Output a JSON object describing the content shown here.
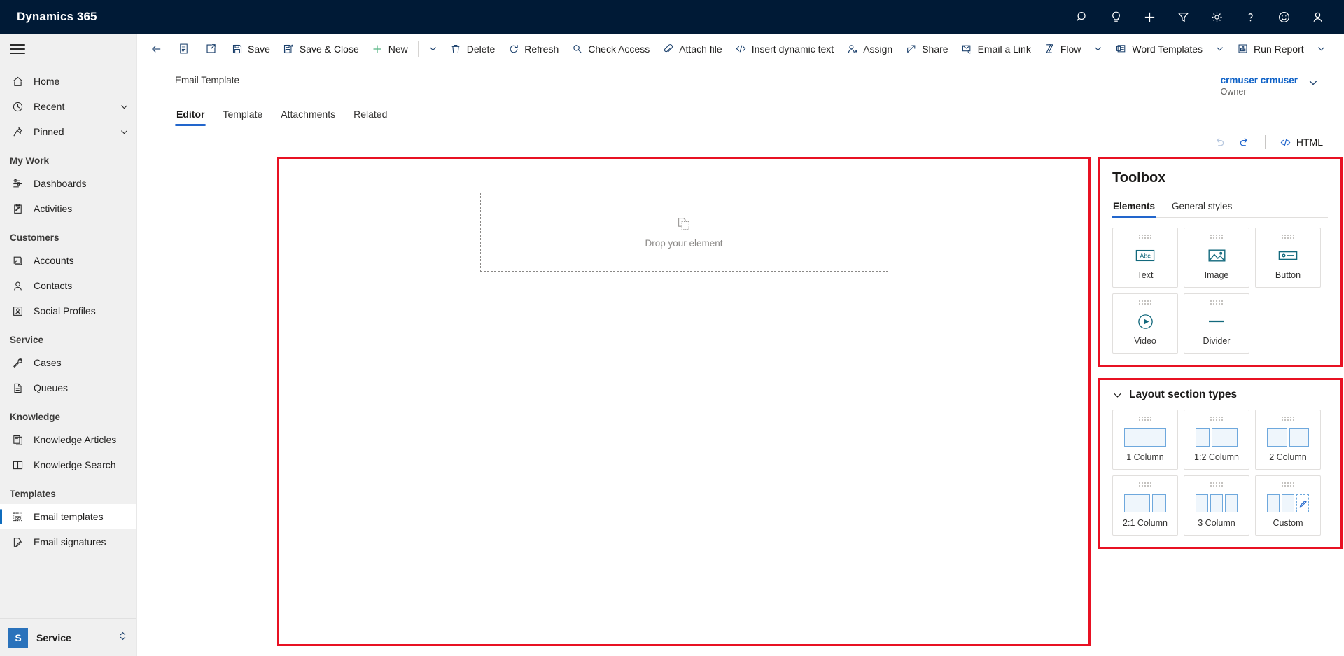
{
  "topbar": {
    "brand": "Dynamics 365",
    "icons": [
      {
        "name": "search-icon",
        "label": "Search"
      },
      {
        "name": "lightbulb-icon",
        "label": "Insights"
      },
      {
        "name": "plus-icon",
        "label": "New"
      },
      {
        "name": "filter-icon",
        "label": "Filter"
      },
      {
        "name": "gear-icon",
        "label": "Settings"
      },
      {
        "name": "question-icon",
        "label": "Help"
      },
      {
        "name": "smiley-icon",
        "label": "Feedback"
      },
      {
        "name": "person-icon",
        "label": "Account manager"
      }
    ]
  },
  "sidebar": {
    "items": [
      {
        "label": "Home",
        "icon": "home-icon",
        "type": "item",
        "chevron": false,
        "selected": false
      },
      {
        "label": "Recent",
        "icon": "clock-icon",
        "type": "item",
        "chevron": true,
        "selected": false
      },
      {
        "label": "Pinned",
        "icon": "pin-icon",
        "type": "item",
        "chevron": true,
        "selected": false
      },
      {
        "label": "My Work",
        "type": "group"
      },
      {
        "label": "Dashboards",
        "icon": "dashboard-icon",
        "type": "item",
        "chevron": false,
        "selected": false
      },
      {
        "label": "Activities",
        "icon": "activities-icon",
        "type": "item",
        "chevron": false,
        "selected": false
      },
      {
        "label": "Customers",
        "type": "group"
      },
      {
        "label": "Accounts",
        "icon": "accounts-icon",
        "type": "item",
        "chevron": false,
        "selected": false
      },
      {
        "label": "Contacts",
        "icon": "contacts-icon",
        "type": "item",
        "chevron": false,
        "selected": false
      },
      {
        "label": "Social Profiles",
        "icon": "social-profile-icon",
        "type": "item",
        "chevron": false,
        "selected": false
      },
      {
        "label": "Service",
        "type": "group"
      },
      {
        "label": "Cases",
        "icon": "wrench-icon",
        "type": "item",
        "chevron": false,
        "selected": false
      },
      {
        "label": "Queues",
        "icon": "queues-icon",
        "type": "item",
        "chevron": false,
        "selected": false
      },
      {
        "label": "Knowledge",
        "type": "group"
      },
      {
        "label": "Knowledge Articles",
        "icon": "article-icon",
        "type": "item",
        "chevron": false,
        "selected": false
      },
      {
        "label": "Knowledge Search",
        "icon": "book-icon",
        "type": "item",
        "chevron": false,
        "selected": false
      },
      {
        "label": "Templates",
        "type": "group"
      },
      {
        "label": "Email templates",
        "icon": "email-template-icon",
        "type": "item",
        "chevron": false,
        "selected": true
      },
      {
        "label": "Email signatures",
        "icon": "signature-icon",
        "type": "item",
        "chevron": false,
        "selected": false
      }
    ],
    "app_switcher": {
      "badge": "S",
      "name": "Service"
    }
  },
  "commandbar": {
    "items": [
      {
        "label": "",
        "icon": "back-arrow-icon",
        "type": "icon-only"
      },
      {
        "label": "",
        "icon": "form-icon",
        "type": "icon-only"
      },
      {
        "label": "",
        "icon": "popout-icon",
        "type": "icon-only"
      },
      {
        "label": "Save",
        "icon": "save-icon",
        "type": "button"
      },
      {
        "label": "Save & Close",
        "icon": "save-close-icon",
        "type": "button"
      },
      {
        "label": "New",
        "icon": "plus-icon",
        "type": "button"
      },
      {
        "label": "",
        "icon": "chevron-down-icon",
        "type": "caret"
      },
      {
        "label": "Delete",
        "icon": "trash-icon",
        "type": "button"
      },
      {
        "label": "Refresh",
        "icon": "refresh-icon",
        "type": "button"
      },
      {
        "label": "Check Access",
        "icon": "key-icon",
        "type": "button"
      },
      {
        "label": "Attach file",
        "icon": "paperclip-icon",
        "type": "button"
      },
      {
        "label": "Insert dynamic text",
        "icon": "code-icon",
        "type": "button"
      },
      {
        "label": "Assign",
        "icon": "assign-icon",
        "type": "button"
      },
      {
        "label": "Share",
        "icon": "share-icon",
        "type": "button"
      },
      {
        "label": "Email a Link",
        "icon": "email-link-icon",
        "type": "button"
      },
      {
        "label": "Flow",
        "icon": "flow-icon",
        "type": "button"
      },
      {
        "label": "",
        "icon": "chevron-down-icon",
        "type": "caret"
      },
      {
        "label": "Word Templates",
        "icon": "word-template-icon",
        "type": "button"
      },
      {
        "label": "",
        "icon": "chevron-down-icon",
        "type": "caret"
      },
      {
        "label": "Run Report",
        "icon": "report-icon",
        "type": "button"
      },
      {
        "label": "",
        "icon": "chevron-down-icon",
        "type": "caret"
      }
    ]
  },
  "record": {
    "entity_label": "Email Template",
    "owner": {
      "name": "crmuser crmuser",
      "role": "Owner"
    },
    "tabs": [
      {
        "label": "Editor",
        "active": true
      },
      {
        "label": "Template",
        "active": false
      },
      {
        "label": "Attachments",
        "active": false
      },
      {
        "label": "Related",
        "active": false
      }
    ]
  },
  "editor": {
    "tools": {
      "undo": {
        "name": "undo-icon",
        "label": "Undo",
        "disabled": true
      },
      "redo": {
        "name": "redo-icon",
        "label": "Redo",
        "disabled": false
      },
      "html_label": "HTML"
    },
    "canvas": {
      "dropzone_text": "Drop your element",
      "dropzone_icon": "copy-page-icon"
    }
  },
  "toolbox": {
    "title": "Toolbox",
    "tabs": [
      {
        "label": "Elements",
        "active": true
      },
      {
        "label": "General styles",
        "active": false
      }
    ],
    "elements": [
      {
        "label": "Text",
        "icon": "abc-text-icon"
      },
      {
        "label": "Image",
        "icon": "image-icon"
      },
      {
        "label": "Button",
        "icon": "button-icon"
      },
      {
        "label": "Video",
        "icon": "video-play-icon"
      },
      {
        "label": "Divider",
        "icon": "divider-icon"
      }
    ]
  },
  "layout_section": {
    "title": "Layout section types",
    "expanded": true,
    "items": [
      {
        "label": "1 Column",
        "icon": "layout-1col-icon",
        "cols": [
          1
        ]
      },
      {
        "label": "1:2 Column",
        "icon": "layout-1-2col-icon",
        "cols": [
          1,
          2
        ]
      },
      {
        "label": "2 Column",
        "icon": "layout-2col-icon",
        "cols": [
          1,
          1
        ]
      },
      {
        "label": "2:1 Column",
        "icon": "layout-2-1col-icon",
        "cols": [
          2,
          1
        ]
      },
      {
        "label": "3 Column",
        "icon": "layout-3col-icon",
        "cols": [
          1,
          1,
          1
        ]
      },
      {
        "label": "Custom",
        "icon": "layout-custom-icon",
        "cols": [
          1,
          1,
          "pencil"
        ]
      }
    ]
  },
  "colors": {
    "topbar_bg": "#001a36",
    "accent_blue": "#2266cc",
    "highlight_red": "#e81123",
    "tile_icon_teal": "#13697d",
    "layout_blue": "#6ea8dd"
  }
}
